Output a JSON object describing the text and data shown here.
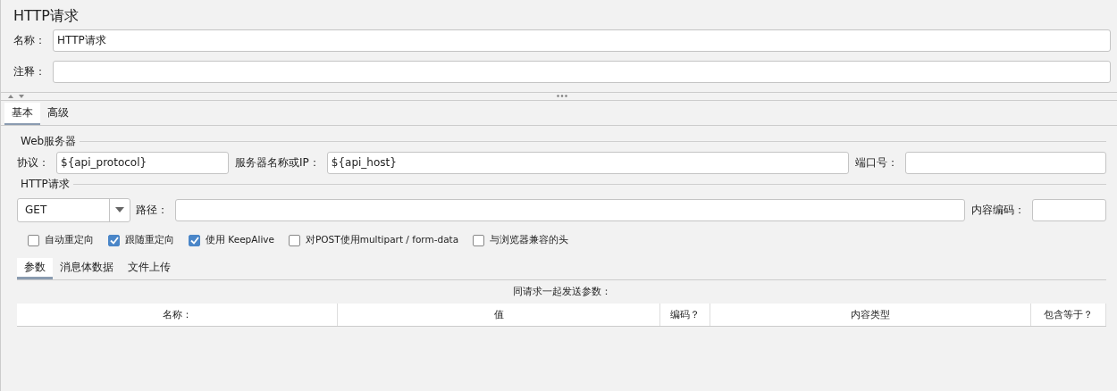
{
  "title": "HTTP请求",
  "fields": [
    {
      "label": "名称：",
      "value": "HTTP请求"
    },
    {
      "label": "注释："
    }
  ],
  "tabs": [
    {
      "label": "基本",
      "selected": true
    },
    {
      "label": "高级",
      "selected": false
    }
  ],
  "web_server": {
    "legend": "Web服务器",
    "protocol_label": "协议：",
    "protocol": "${api_protocol}",
    "server_label": "服务器名称或IP：",
    "server": "${api_host}",
    "port_label": "端口号："
  },
  "http_request": {
    "legend": "HTTP请求",
    "method": "GET",
    "path_label": "路径：",
    "encoding_label": "内容编码："
  },
  "checkboxes": [
    {
      "label": "自动重定向",
      "checked": false
    },
    {
      "label": "跟随重定向",
      "checked": true
    },
    {
      "label": "使用 KeepAlive",
      "checked": true
    },
    {
      "label": "对POST使用multipart / form-data",
      "checked": false
    },
    {
      "label": "与浏览器兼容的头",
      "checked": false
    }
  ],
  "subtabs": [
    {
      "label": "参数",
      "selected": true
    },
    {
      "label": "消息体数据",
      "selected": false
    },
    {
      "label": "文件上传",
      "selected": false
    }
  ],
  "table": {
    "caption": "同请求一起发送参数：",
    "columns": [
      "名称：",
      "值",
      "编码？",
      "内容类型",
      "包含等于？"
    ]
  }
}
